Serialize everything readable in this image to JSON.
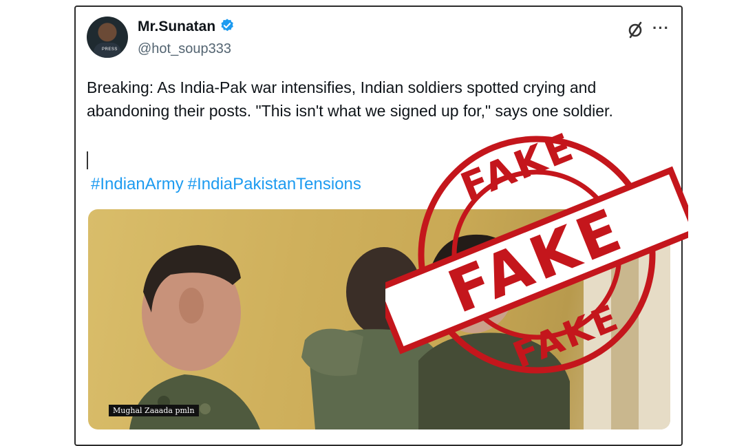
{
  "author": {
    "name": "Mr.Sunatan",
    "handle": "@hot_soup333",
    "avatar_text": "PRESS"
  },
  "tweet": {
    "text": "Breaking: As India-Pak war intensifies, Indian soldiers spotted crying and abandoning their posts. \"This isn't what we signed up for,\" says one soldier.",
    "hashtags": [
      "#IndianArmy",
      "#IndiaPakistanTensions"
    ]
  },
  "media": {
    "watermark": "Mughal Zaaada pmln"
  },
  "stamp": {
    "words": [
      "FAKE",
      "FAKE",
      "FAKE"
    ],
    "color": "#c4161c"
  },
  "colors": {
    "link": "#1d9bf0",
    "verified": "#1d9bf0",
    "stamp": "#c4161c"
  },
  "icons": [
    "verified-badge-icon",
    "grok-icon",
    "more-options-icon"
  ]
}
